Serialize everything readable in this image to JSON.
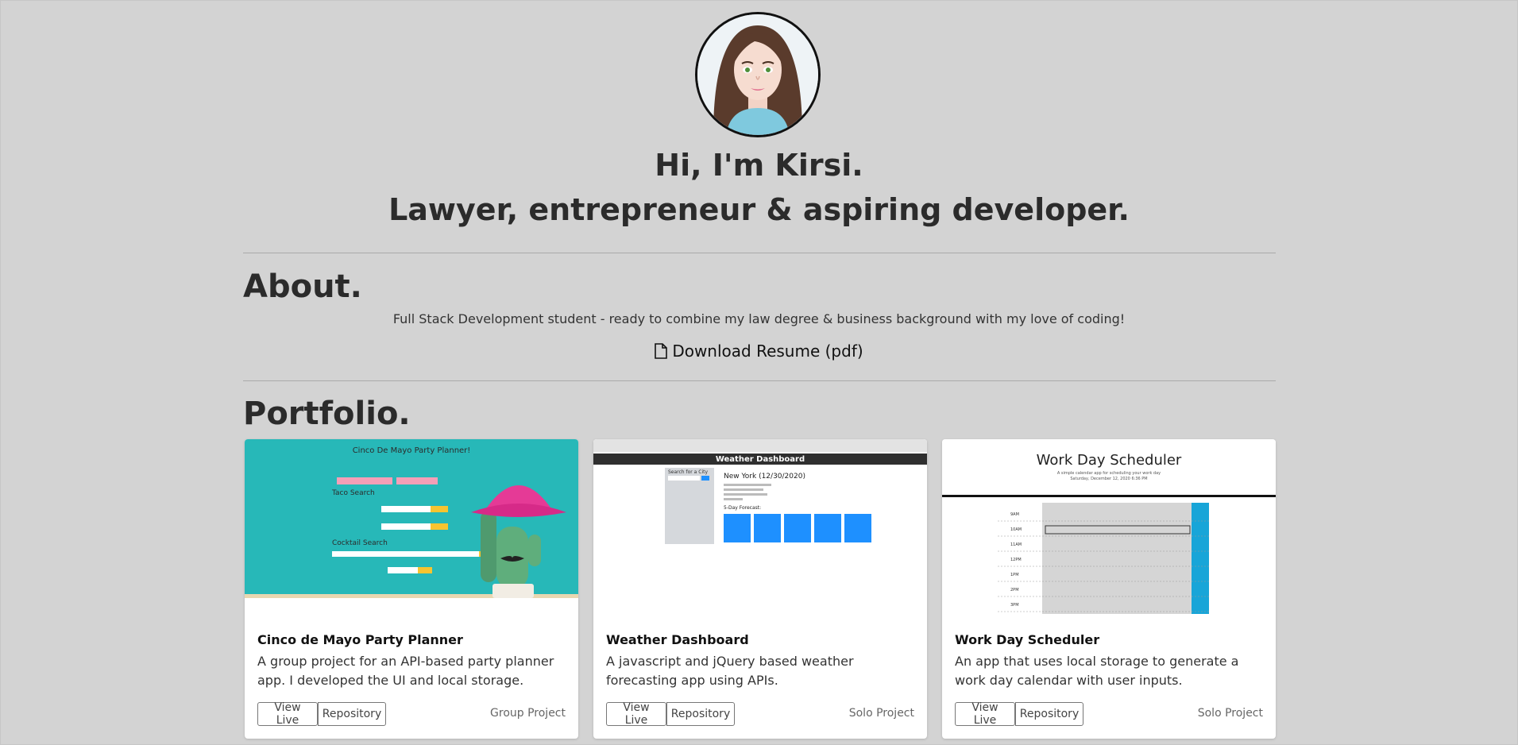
{
  "header": {
    "greeting": "Hi, I'm Kirsi.",
    "tagline": "Lawyer, entrepreneur & aspiring developer."
  },
  "about": {
    "title": "About.",
    "text": "Full Stack Development student - ready to combine my law degree & business background with my love of coding!",
    "resume_link": "Download Resume (pdf)",
    "resume_icon": "document-icon"
  },
  "portfolio": {
    "title": "Portfolio.",
    "projects": [
      {
        "title": "Cinco de Mayo Party Planner",
        "description": "A group project for an API-based party planner app. I developed the UI and local storage.",
        "live_label": "View Live",
        "repo_label": "Repository",
        "kind": "Group Project",
        "shot": {
          "heading": "Cinco De Mayo Party Planner!",
          "section1": "Taco Search",
          "section2": "Cocktail Search"
        }
      },
      {
        "title": "Weather Dashboard",
        "description": "A javascript and jQuery based weather forecasting app using APIs.",
        "live_label": "View Live",
        "repo_label": "Repository",
        "kind": "Solo Project",
        "shot": {
          "heading": "Weather Dashboard",
          "search_label": "Search for a City",
          "city": "New York (12/30/2020)",
          "forecast_label": "5-Day Forecast:"
        }
      },
      {
        "title": "Work Day Scheduler",
        "description": "An app that uses local storage to generate a work day calendar with user inputs.",
        "live_label": "View Live",
        "repo_label": "Repository",
        "kind": "Solo Project",
        "shot": {
          "heading": "Work Day Scheduler",
          "subheading": "A simple calendar app for scheduling your work day",
          "date": "Saturday, December 12, 2020 6:36 PM",
          "hours": [
            "9AM",
            "10AM",
            "11AM",
            "12PM",
            "1PM",
            "2PM",
            "3PM"
          ]
        }
      }
    ]
  },
  "colors": {
    "background": "#d3d3d3",
    "card": "#ffffff",
    "turquoise": "#27b8b8",
    "weather_blue": "#1e90ff",
    "scheduler_blue": "#18a5d8"
  }
}
